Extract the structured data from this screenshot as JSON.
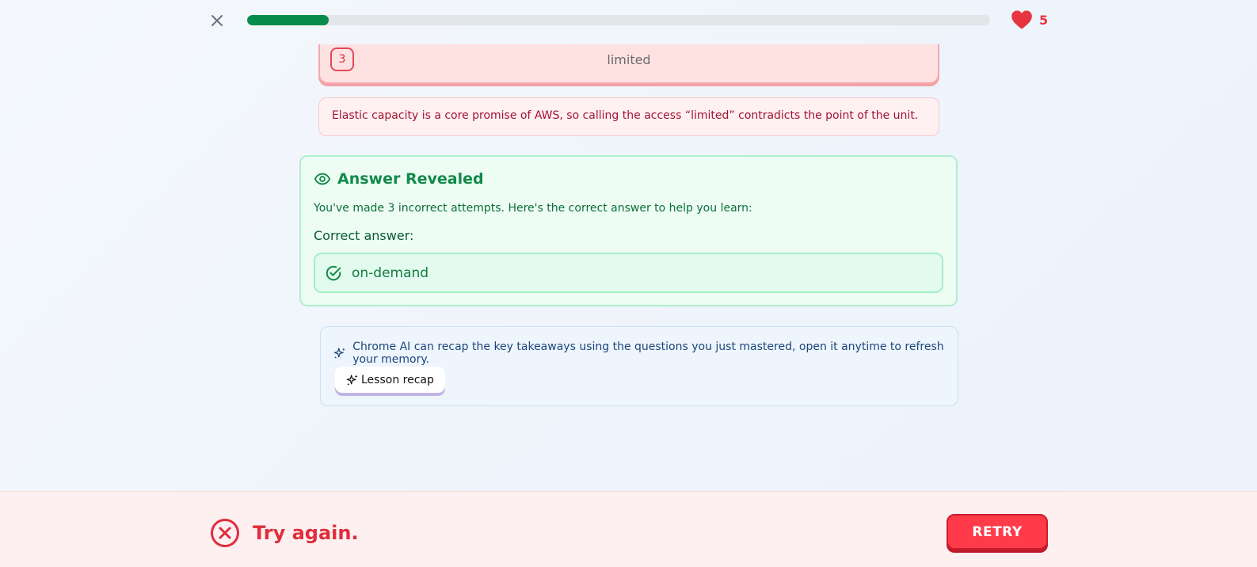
{
  "header": {
    "progress_fraction": 0.11,
    "hearts_count": "5",
    "colors": {
      "progress": "#078b4a",
      "heart": "#e63541"
    }
  },
  "option": {
    "number": "3",
    "text": "limited"
  },
  "feedback": {
    "text": "Elastic capacity is a core promise of AWS, so calling the access “limited” contradicts the point of the unit."
  },
  "reveal": {
    "title": "Answer Revealed",
    "description": "You've made 3 incorrect attempts. Here's the correct answer to help you learn:",
    "label": "Correct answer:",
    "answer": "on-demand"
  },
  "ai_recap": {
    "text": "Chrome AI can recap the key takeaways using the questions you just mastered, open it anytime to refresh your memory.",
    "button_label": "Lesson recap"
  },
  "footer": {
    "status_text": "Try again.",
    "retry_label": "RETRY",
    "colors": {
      "status": "#e02d3c",
      "retry_bg": "#ff3b4a"
    }
  },
  "icons": {
    "close": "close-icon",
    "heart": "heart-icon",
    "eye": "eye-icon",
    "check": "check-circle-icon",
    "sparkles": "sparkles-icon",
    "status": "x-circle-icon"
  }
}
